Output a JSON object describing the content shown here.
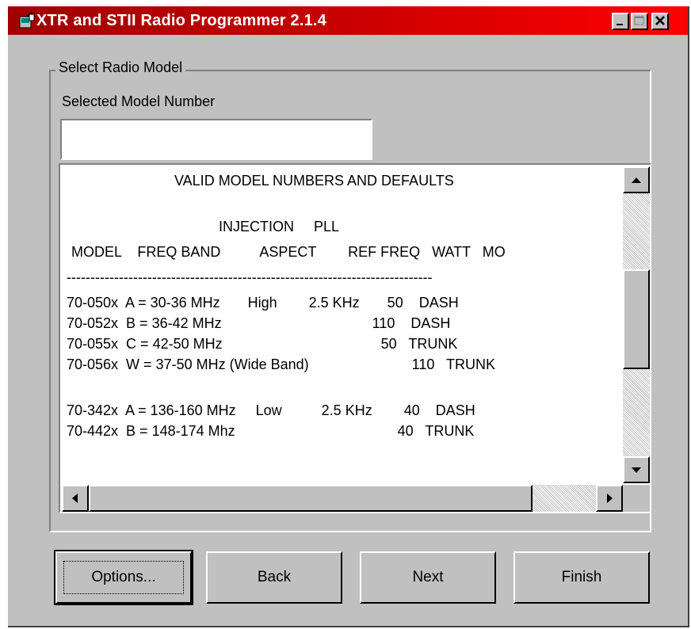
{
  "window": {
    "title": "XTR and STII Radio Programmer 2.1.4",
    "icon": "app-icon",
    "title_gradient": [
      "#a00000",
      "#ff0000"
    ]
  },
  "group": {
    "legend": "Select Radio Model",
    "model_label": "Selected Model Number",
    "model_value": ""
  },
  "list": {
    "lines": [
      "VALID MODEL NUMBERS AND DEFAULTS",
      "INJECTION     PLL",
      "MODEL    FREQ BAND          ASPECT        REF FREQ   WATT   MO",
      "-----------------------------------------------------------------------------",
      "70-050x  A = 30-36 MHz       High        2.5 KHz       50    DASH",
      "70-052x  B = 36-42 MHz                                      110    DASH",
      "70-055x  C = 42-50 MHz                                        50   TRUNK",
      "70-056x  W = 37-50 MHz (Wide Band)                          110   TRUNK",
      "70-342x  A = 136-160 MHz     Low          2.5 KHz        40    DASH",
      "70-442x  B = 148-174 Mhz                                         40   TRUNK"
    ]
  },
  "buttons": {
    "options": "Options...",
    "back": "Back",
    "next": "Next",
    "finish": "Finish"
  }
}
